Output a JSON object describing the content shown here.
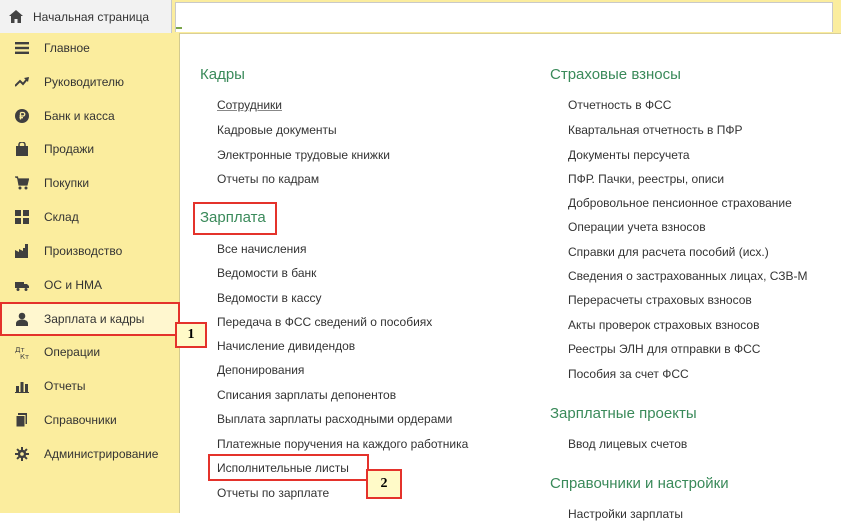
{
  "topbar": {
    "home_label": "Начальная страница"
  },
  "sidebar": {
    "items": [
      {
        "label": "Главное",
        "icon": "menu-icon"
      },
      {
        "label": "Руководителю",
        "icon": "trend-icon"
      },
      {
        "label": "Банк и касса",
        "icon": "ruble-coin-icon"
      },
      {
        "label": "Продажи",
        "icon": "shopping-bag-icon"
      },
      {
        "label": "Покупки",
        "icon": "cart-icon"
      },
      {
        "label": "Склад",
        "icon": "warehouse-grid-icon"
      },
      {
        "label": "Производство",
        "icon": "factory-icon"
      },
      {
        "label": "ОС и НМА",
        "icon": "truck-icon"
      },
      {
        "label": "Зарплата и кадры",
        "icon": "person-icon"
      },
      {
        "label": "Операции",
        "icon": "debit-credit-icon"
      },
      {
        "label": "Отчеты",
        "icon": "bar-chart-icon"
      },
      {
        "label": "Справочники",
        "icon": "books-icon"
      },
      {
        "label": "Администрирование",
        "icon": "gear-icon"
      }
    ]
  },
  "callouts": {
    "first": "1",
    "second": "2"
  },
  "left_column": {
    "kadry": {
      "title": "Кадры",
      "links": [
        "Сотрудники",
        "Кадровые документы",
        "Электронные трудовые книжки",
        "Отчеты по кадрам"
      ]
    },
    "zarplata": {
      "title": "Зарплата",
      "links": [
        "Все начисления",
        "Ведомости в банк",
        "Ведомости в кассу",
        "Передача в ФСС сведений о пособиях",
        "Начисление дивидендов",
        "Депонирования",
        "Списания зарплаты депонентов",
        "Выплата зарплаты расходными ордерами",
        "Платежные поручения на каждого работника",
        "Исполнительные листы",
        "Отчеты по зарплате"
      ]
    }
  },
  "right_column": {
    "strakhovye": {
      "title": "Страховые взносы",
      "links": [
        "Отчетность в ФСС",
        "Квартальная отчетность в ПФР",
        "Документы персучета",
        "ПФР. Пачки, реестры, описи",
        "Добровольное пенсионное страхование",
        "Операции учета взносов",
        "Справки для расчета пособий (исх.)",
        "Сведения о застрахованных лицах, СЗВ-М",
        "Перерасчеты страховых взносов",
        "Акты проверок страховых взносов",
        "Реестры ЭЛН для отправки в ФСС",
        "Пособия за счет ФСС"
      ]
    },
    "proekty": {
      "title": "Зарплатные проекты",
      "links": [
        "Ввод лицевых счетов"
      ]
    },
    "spravochniki": {
      "title": "Справочники и настройки",
      "links": [
        "Настройки зарплаты"
      ]
    }
  },
  "colors": {
    "sidebar_bg": "#fbed9e",
    "section_title": "#3a8a5a",
    "highlight": "#e4322b"
  }
}
